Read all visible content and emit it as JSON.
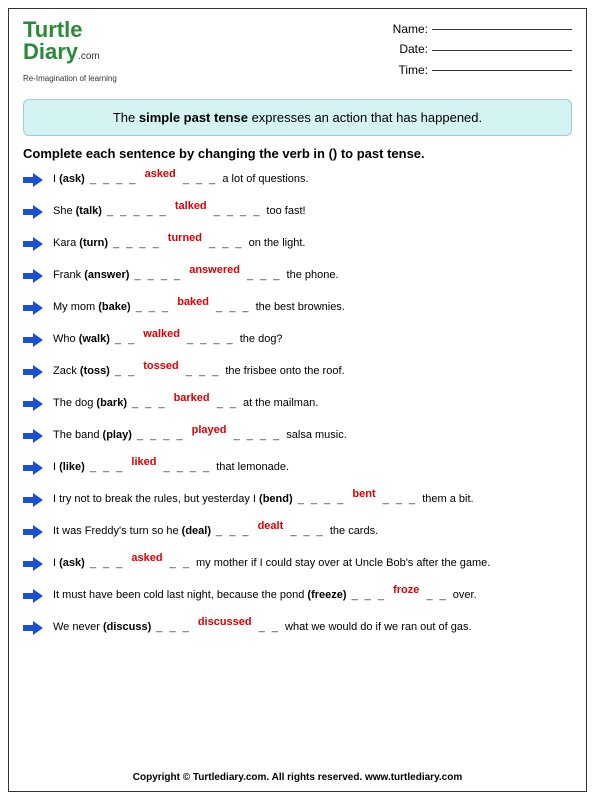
{
  "logo": {
    "line1": "Turtle",
    "line2": "Diary",
    "dotcom": ".com",
    "tagline": "Re-Imagination of learning"
  },
  "meta": {
    "name_label": "Name:",
    "date_label": "Date:",
    "time_label": "Time:"
  },
  "info_prefix": "The ",
  "info_bold": "simple past tense",
  "info_suffix": " expresses an action that has happened.",
  "instruction": "Complete each sentence by changing the verb in () to past tense.",
  "items": [
    {
      "pre": "I ",
      "verb": "(ask)",
      "blank1": " _ _ _ _ ",
      "answer": "asked",
      "blank2": " _ _ _ ",
      "post": "a lot of questions."
    },
    {
      "pre": "She ",
      "verb": "(talk)",
      "blank1": " _ _ _ _ _ ",
      "answer": "talked",
      "blank2": " _ _ _ _ ",
      "post": "too fast!"
    },
    {
      "pre": "Kara ",
      "verb": "(turn)",
      "blank1": " _ _ _ _ ",
      "answer": "turned",
      "blank2": " _ _ _ ",
      "post": "on the light."
    },
    {
      "pre": "Frank ",
      "verb": "(answer)",
      "blank1": " _ _ _ _ ",
      "answer": "answered",
      "blank2": " _ _ _ ",
      "post": "the phone."
    },
    {
      "pre": "My mom ",
      "verb": "(bake)",
      "blank1": " _ _ _ ",
      "answer": "baked",
      "blank2": " _ _ _ ",
      "post": "the best brownies."
    },
    {
      "pre": "Who ",
      "verb": "(walk)",
      "blank1": " _ _ ",
      "answer": "walked",
      "blank2": " _ _ _ _ ",
      "post": "the dog?"
    },
    {
      "pre": "Zack ",
      "verb": "(toss)",
      "blank1": " _ _ ",
      "answer": "tossed",
      "blank2": " _ _ _ ",
      "post": "the frisbee onto the roof."
    },
    {
      "pre": "The dog ",
      "verb": "(bark)",
      "blank1": " _ _ _ ",
      "answer": "barked",
      "blank2": " _ _ ",
      "post": "at the mailman."
    },
    {
      "pre": "The band ",
      "verb": "(play)",
      "blank1": " _ _ _ _ ",
      "answer": "played",
      "blank2": " _ _ _ _ ",
      "post": "salsa music."
    },
    {
      "pre": "I ",
      "verb": "(like)",
      "blank1": " _ _ _ ",
      "answer": "liked",
      "blank2": " _ _ _ _ ",
      "post": "that lemonade."
    },
    {
      "pre": "I try not to break the rules, but yesterday I ",
      "verb": "(bend)",
      "blank1": "  _ _ _ _ ",
      "answer": "bent",
      "blank2": " _ _ _ ",
      "post": "them a bit."
    },
    {
      "pre": "It was Freddy's turn so he ",
      "verb": "(deal)",
      "blank1": "  _ _ _ ",
      "answer": "dealt",
      "blank2": " _ _ _ ",
      "post": "the cards."
    },
    {
      "pre": "I ",
      "verb": "(ask)",
      "blank1": " _ _ _ ",
      "answer": "asked",
      "blank2": " _ _ ",
      "post": "my mother if I could stay over at Uncle Bob's after the game."
    },
    {
      "pre": "It must have been cold last night, because the pond ",
      "verb": "(freeze)",
      "blank1": "  _ _ _ ",
      "answer": "froze",
      "blank2": " _ _ ",
      "post": "over."
    },
    {
      "pre": "We never ",
      "verb": "(discuss)",
      "blank1": " _ _ _ ",
      "answer": "discussed",
      "blank2": " _ _ ",
      "post": "what we would do if we ran out of gas."
    }
  ],
  "footer": "Copyright © Turtlediary.com. All rights reserved.   www.turtlediary.com"
}
